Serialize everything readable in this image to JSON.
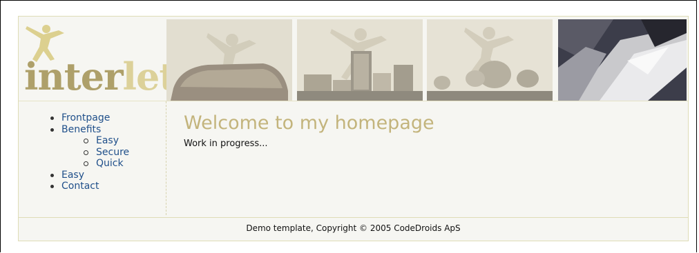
{
  "header": {
    "logo_part1": "inter",
    "logo_part2": "let",
    "photos": [
      "uluru-photo",
      "city-skyline-photo",
      "satellite-dishes-photo",
      "bird-feather-photo"
    ]
  },
  "nav": {
    "items": [
      {
        "label": "Frontpage"
      },
      {
        "label": "Benefits",
        "children": [
          {
            "label": "Easy"
          },
          {
            "label": "Secure"
          },
          {
            "label": "Quick"
          }
        ]
      },
      {
        "label": "Easy"
      },
      {
        "label": "Contact"
      }
    ]
  },
  "main": {
    "title": "Welcome to my homepage",
    "body": "Work in progress..."
  },
  "footer": {
    "text": "Demo template, Copyright © 2005 CodeDroids ApS"
  },
  "colors": {
    "accent": "#c3b47c",
    "logo_dark": "#aea06a",
    "logo_light": "#dcd199",
    "link": "#1f4f8a",
    "page_bg": "#f6f6f2",
    "border": "#dedcb6"
  }
}
